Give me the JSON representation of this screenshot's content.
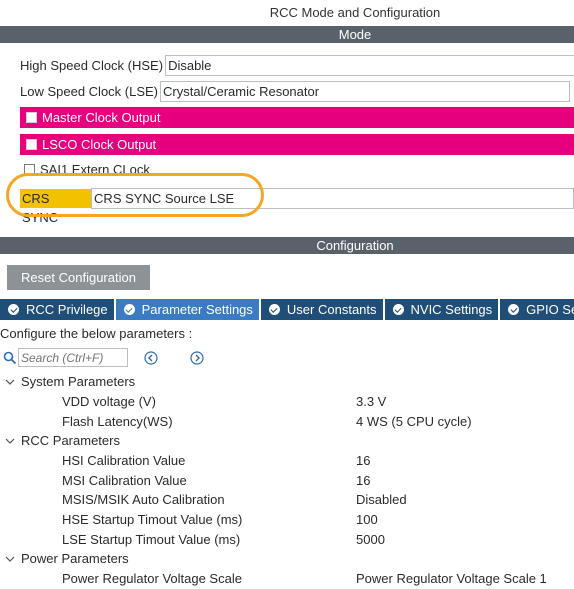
{
  "window": {
    "title": "RCC Mode and Configuration"
  },
  "mode": {
    "header": "Mode",
    "hse": {
      "label": "High Speed Clock (HSE)",
      "value": "Disable"
    },
    "lse": {
      "label": "Low Speed Clock (LSE)",
      "value": "Crystal/Ceramic Resonator"
    },
    "master_clock_output": "Master Clock Output",
    "lsco_clock_output": "LSCO Clock Output",
    "sai1_extern_clock": "SAI1 Extern CLock",
    "crs_sync": {
      "label": "CRS SYNC",
      "value": "CRS SYNC Source LSE"
    }
  },
  "configuration": {
    "header": "Configuration",
    "reset_label": "Reset Configuration",
    "tabs": [
      {
        "label": "RCC Privilege",
        "active": false
      },
      {
        "label": "Parameter Settings",
        "active": true
      },
      {
        "label": "User Constants",
        "active": false
      },
      {
        "label": "NVIC Settings",
        "active": false
      },
      {
        "label": "GPIO Settings",
        "active": false
      }
    ],
    "configure_text": "Configure the below parameters :",
    "search_placeholder": "Search (Ctrl+F)",
    "groups": [
      {
        "name": "System Parameters",
        "params": [
          {
            "label": "VDD voltage (V)",
            "value": "3.3 V"
          },
          {
            "label": "Flash Latency(WS)",
            "value": "4 WS (5 CPU cycle)"
          }
        ]
      },
      {
        "name": "RCC Parameters",
        "params": [
          {
            "label": "HSI Calibration Value",
            "value": "16"
          },
          {
            "label": "MSI Calibration Value",
            "value": "16"
          },
          {
            "label": "MSIS/MSIK Auto Calibration",
            "value": "Disabled"
          },
          {
            "label": "HSE Startup Timout Value (ms)",
            "value": "100"
          },
          {
            "label": "LSE Startup Timout Value (ms)",
            "value": "5000"
          }
        ]
      },
      {
        "name": "Power Parameters",
        "params": [
          {
            "label": "Power Regulator Voltage Scale",
            "value": "Power Regulator Voltage Scale 1"
          }
        ]
      }
    ]
  },
  "colors": {
    "accent_pink": "#e6007e",
    "tab_blue": "#1f4e79",
    "highlight": "#f5a623"
  }
}
